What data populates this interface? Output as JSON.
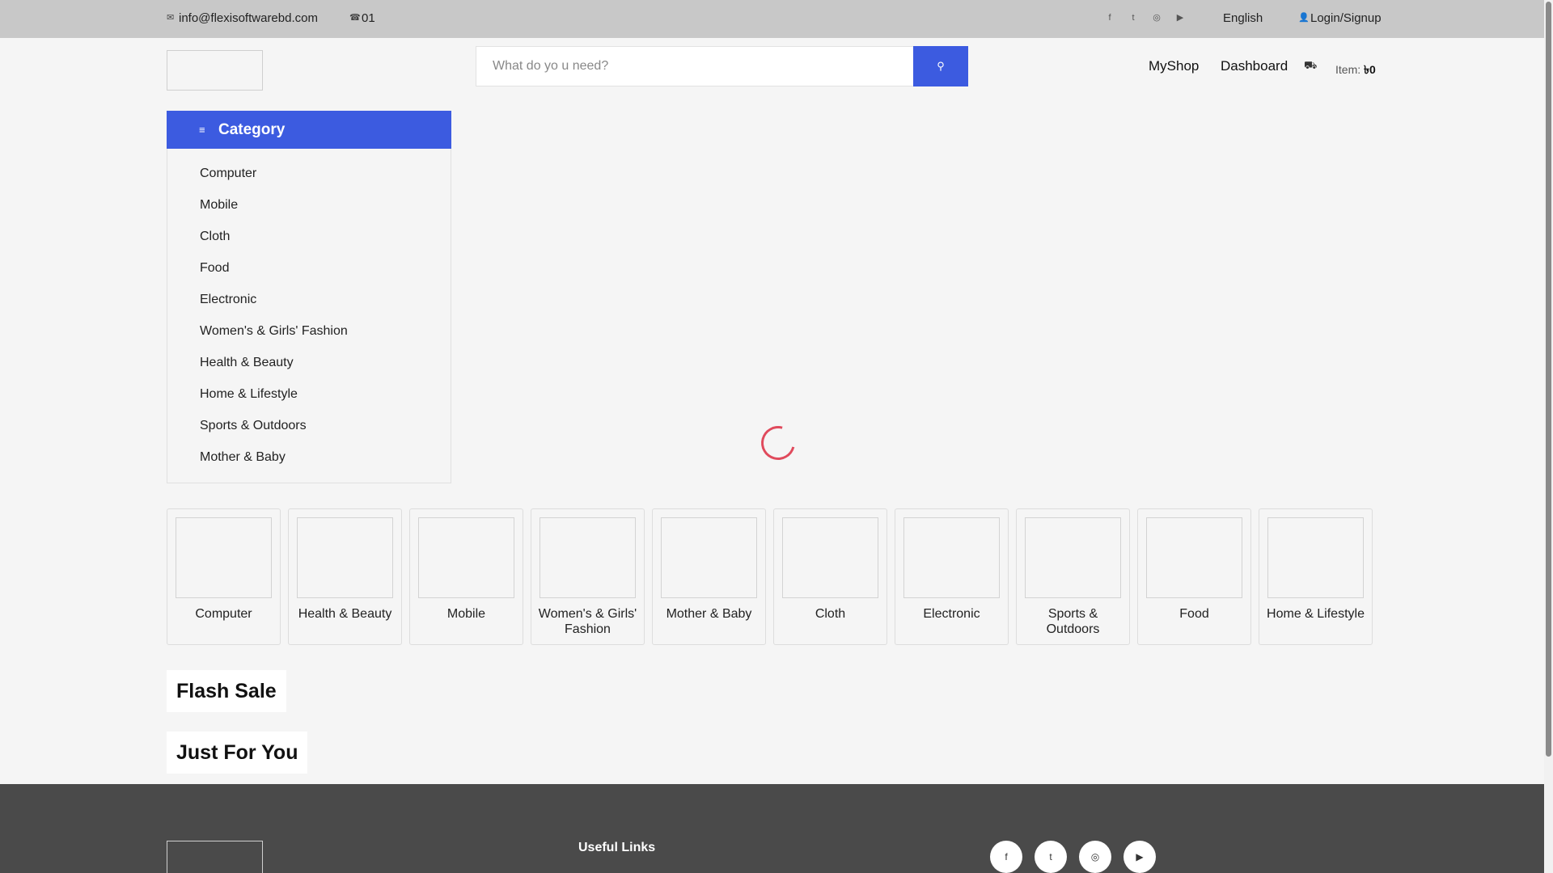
{
  "topbar": {
    "email": "info@flexisoftwarebd.com",
    "phone": "01",
    "language": "English",
    "login": "Login/Signup",
    "social_icons": [
      "facebook-icon",
      "twitter-icon",
      "instagram-icon",
      "youtube-icon"
    ]
  },
  "search": {
    "placeholder": "What do yo u need?"
  },
  "header": {
    "myshop": "MyShop",
    "dashboard": "Dashboard",
    "cart_item_label": "Item:",
    "cart_total": "৳0"
  },
  "sidebar": {
    "title": "Category",
    "items": [
      {
        "label": "Computer"
      },
      {
        "label": "Mobile"
      },
      {
        "label": "Cloth"
      },
      {
        "label": "Food"
      },
      {
        "label": "Electronic"
      },
      {
        "label": "Women's & Girls' Fashion"
      },
      {
        "label": "Health & Beauty"
      },
      {
        "label": "Home & Lifestyle"
      },
      {
        "label": "Sports & Outdoors"
      },
      {
        "label": "Mother & Baby"
      }
    ]
  },
  "cards": [
    {
      "label": "Computer"
    },
    {
      "label": "Health & Beauty"
    },
    {
      "label": "Mobile"
    },
    {
      "label": "Women's & Girls' Fashion"
    },
    {
      "label": "Mother & Baby"
    },
    {
      "label": "Cloth"
    },
    {
      "label": "Electronic"
    },
    {
      "label": "Sports & Outdoors"
    },
    {
      "label": "Food"
    },
    {
      "label": "Home & Lifestyle"
    }
  ],
  "sections": {
    "flash_sale": "Flash Sale",
    "just_for_you": "Just For You"
  },
  "footer": {
    "useful_links": "Useful Links",
    "social_icons": [
      "facebook-icon",
      "twitter-icon",
      "instagram-icon",
      "youtube-icon"
    ]
  },
  "colors": {
    "accent": "#3c5be0",
    "topbar": "#c8c8c8",
    "footer": "#4a4a4a",
    "spinner": "#e04a5c"
  }
}
